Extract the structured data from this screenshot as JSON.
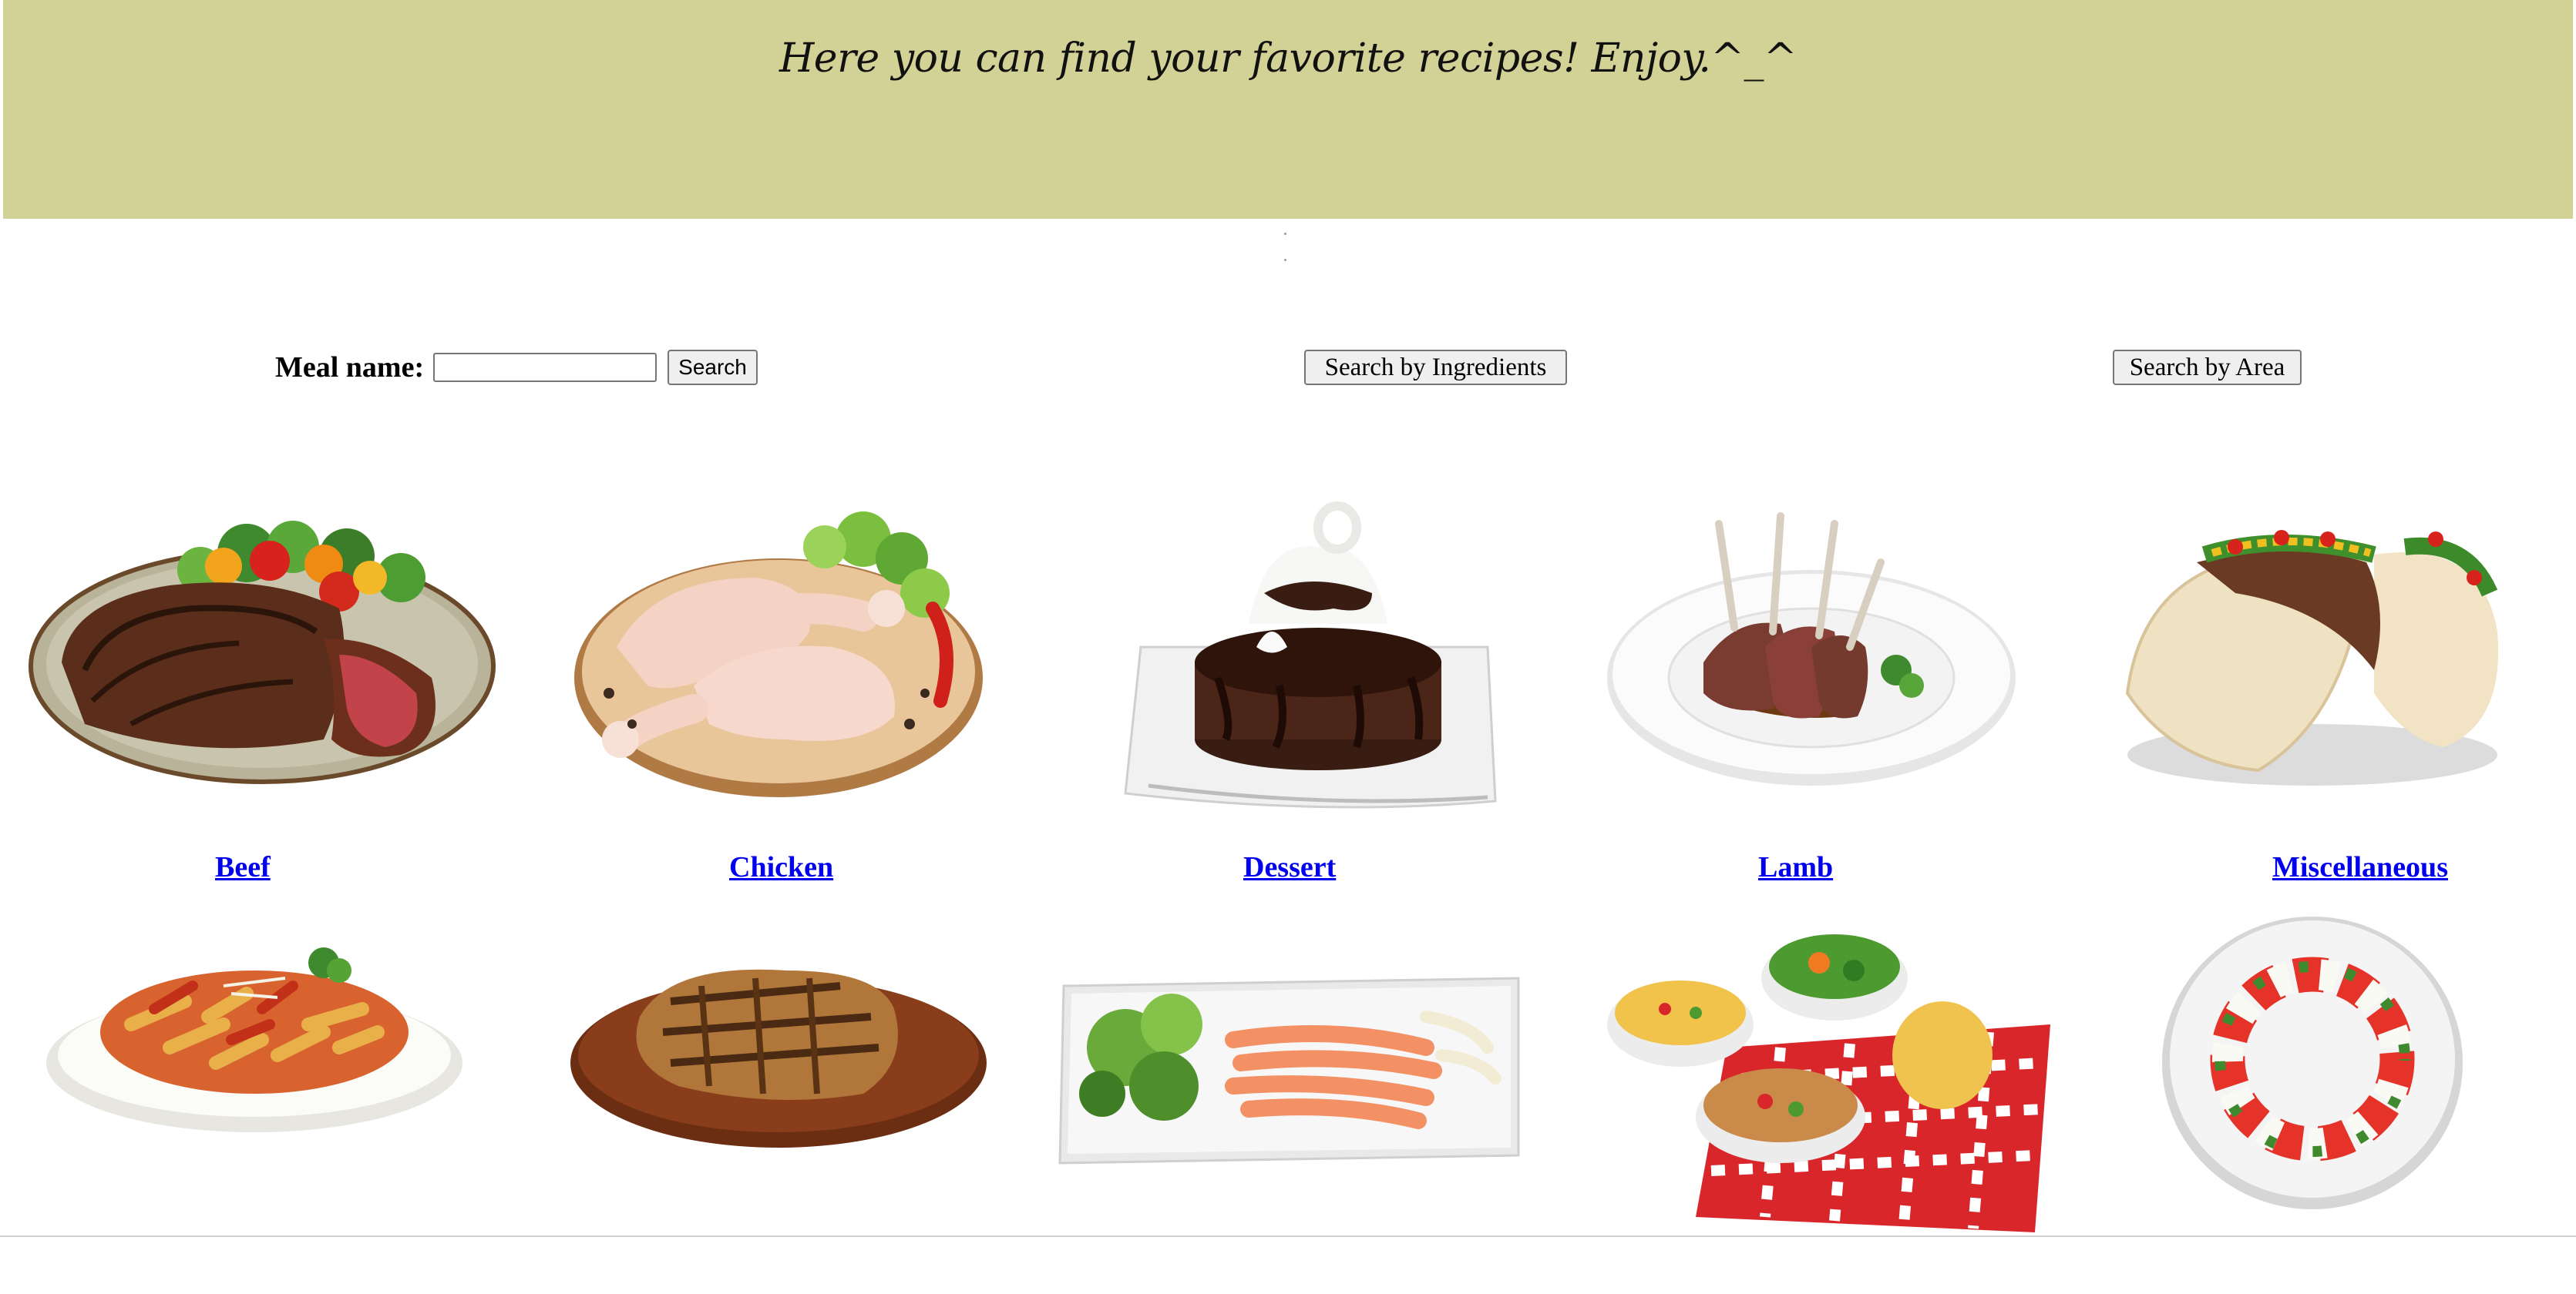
{
  "banner": {
    "title": "Here you can find your favorite recipes! Enjoy.^_^",
    "bg_color": "#d3d296"
  },
  "search": {
    "meal_label": "Meal name:",
    "meal_value": "",
    "search_button": "Search",
    "ingredients_button": "Search by Ingredients",
    "area_button": "Search by Area"
  },
  "categories": [
    {
      "name": "Beef",
      "icon": "steak-with-salad-image"
    },
    {
      "name": "Chicken",
      "icon": "raw-chicken-legs-image"
    },
    {
      "name": "Dessert",
      "icon": "chocolate-lava-cake-image"
    },
    {
      "name": "Lamb",
      "icon": "lamb-chops-image"
    },
    {
      "name": "Miscellaneous",
      "icon": "tacos-image"
    }
  ],
  "row2_images": [
    {
      "icon": "penne-pasta-image"
    },
    {
      "icon": "grilled-pork-chop-image"
    },
    {
      "icon": "salmon-carpaccio-image"
    },
    {
      "icon": "side-dishes-with-cornbread-image"
    },
    {
      "icon": "caprese-salad-image"
    }
  ],
  "colors": {
    "link": "#0000ee",
    "banner": "#d3d296"
  }
}
